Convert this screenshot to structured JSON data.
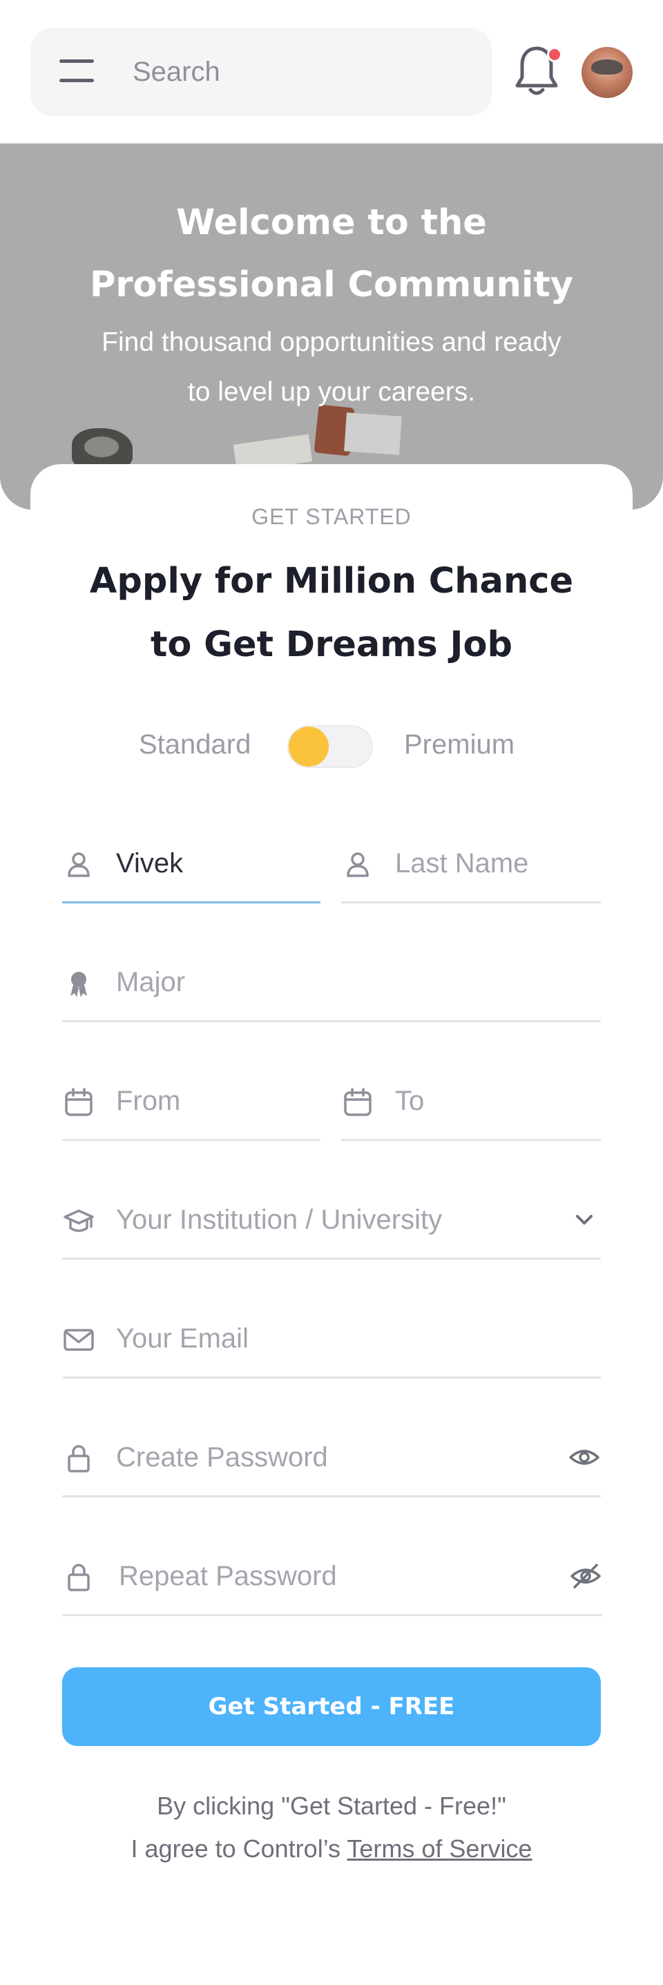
{
  "header": {
    "menu_icon": "hamburger-menu-icon",
    "search_placeholder": "Search",
    "notification_icon": "bell-icon",
    "notification_dot_color": "#f2545b",
    "avatar": "user-avatar"
  },
  "hero": {
    "title_line1": "Welcome to the",
    "title_line2": "Professional Community",
    "subtitle_line1": "Find thousand opportunities and ready",
    "subtitle_line2": "to level up your careers."
  },
  "form": {
    "eyebrow": "GET STARTED",
    "title_line1": "Apply for Million Chance",
    "title_line2": "to Get Dreams Job",
    "plan_toggle": {
      "left_label": "Standard",
      "right_label": "Premium",
      "knob_color": "#fbc23c"
    },
    "first_name": {
      "value": "Vivek",
      "icon": "user-icon"
    },
    "last_name": {
      "placeholder": "Last Name",
      "icon": "user-icon"
    },
    "major": {
      "placeholder": "Major",
      "icon": "award-icon"
    },
    "from": {
      "placeholder": "From",
      "icon": "calendar-icon"
    },
    "to": {
      "placeholder": "To",
      "icon": "calendar-icon"
    },
    "institution": {
      "placeholder": "Your Institution / University",
      "icon": "graduation-cap-icon",
      "trail_icon": "chevron-down-icon"
    },
    "email": {
      "placeholder": "Your Email",
      "icon": "mail-icon"
    },
    "create_password": {
      "placeholder": "Create Password",
      "icon": "lock-icon",
      "trail_icon": "eye-icon"
    },
    "repeat_password": {
      "placeholder": "Repeat Password",
      "icon": "lock-icon",
      "trail_icon": "eye-off-icon"
    },
    "submit_label": "Get Started -  FREE",
    "submit_color": "#4db3fb",
    "terms_line1": "By clicking \"Get Started - Free!\"",
    "terms_line2_prefix": "I agree to Control’s ",
    "terms_link": "Terms of Service"
  }
}
